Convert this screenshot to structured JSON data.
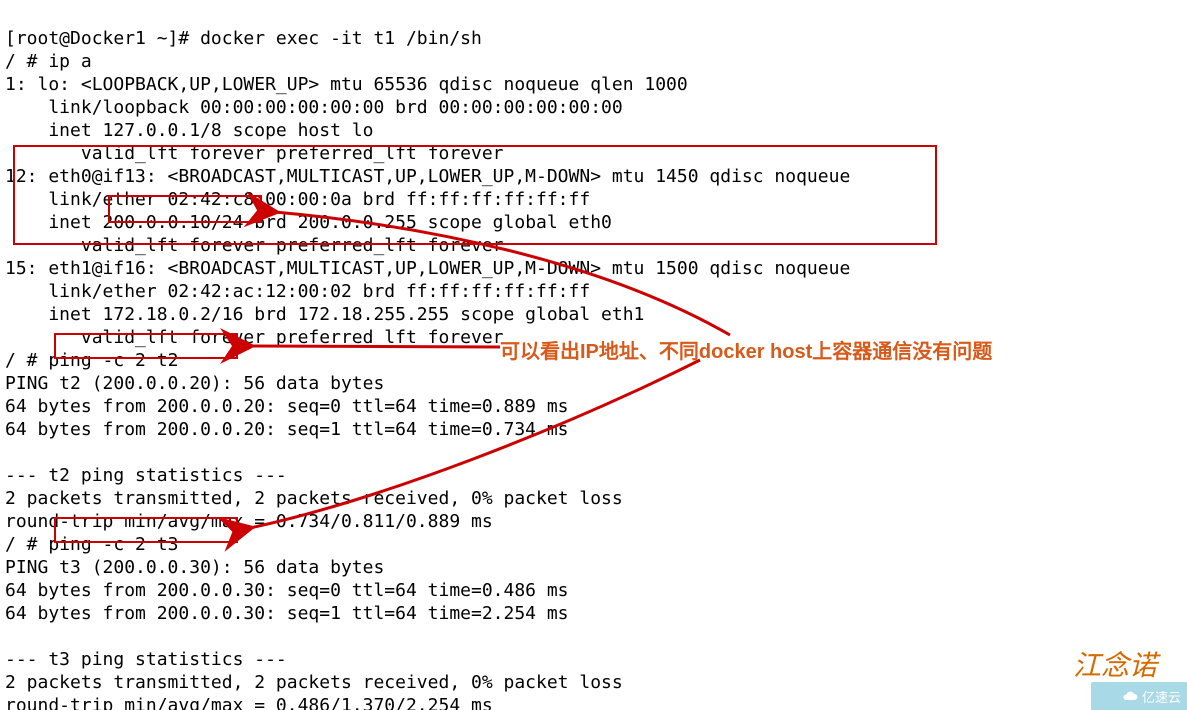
{
  "prompt1": "[root@Docker1 ~]# docker exec -it t1 /bin/sh",
  "prompt2": "/ # ip a",
  "lo_header": "1: lo: <LOOPBACK,UP,LOWER_UP> mtu 65536 qdisc noqueue qlen 1000",
  "lo_link": "    link/loopback 00:00:00:00:00:00 brd 00:00:00:00:00:00",
  "lo_inet": "    inet 127.0.0.1/8 scope host lo",
  "lo_valid": "       valid_lft forever preferred_lft forever",
  "eth0_header": "12: eth0@if13: <BROADCAST,MULTICAST,UP,LOWER_UP,M-DOWN> mtu 1450 qdisc noqueue",
  "eth0_link": "    link/ether 02:42:c8:00:00:0a brd ff:ff:ff:ff:ff:ff",
  "eth0_inet_pre": "    inet ",
  "eth0_ip": "200.0.0.10/24",
  "eth0_inet_post": " brd 200.0.0.255 scope global eth0",
  "eth0_valid": "       valid_lft forever preferred_lft forever",
  "eth1_header": "15: eth1@if16: <BROADCAST,MULTICAST,UP,LOWER_UP,M-DOWN> mtu 1500 qdisc noqueue",
  "eth1_link": "    link/ether 02:42:ac:12:00:02 brd ff:ff:ff:ff:ff:ff",
  "eth1_inet": "    inet 172.18.0.2/16 brd 172.18.255.255 scope global eth1",
  "eth1_valid": "       valid_lft forever preferred_lft forever",
  "ping_t2_prompt_pre": "/ # ",
  "ping_t2_cmd": "ping -c 2 t2",
  "ping_t2_line1": "PING t2 (200.0.0.20): 56 data bytes",
  "ping_t2_line2": "64 bytes from 200.0.0.20: seq=0 ttl=64 time=0.889 ms",
  "ping_t2_line3": "64 bytes from 200.0.0.20: seq=1 ttl=64 time=0.734 ms",
  "blank": "",
  "ping_t2_stats_hdr": "--- t2 ping statistics ---",
  "ping_t2_stats1": "2 packets transmitted, 2 packets received, 0% packet loss",
  "ping_t2_stats2": "round-trip min/avg/max = 0.734/0.811/0.889 ms",
  "ping_t3_prompt_pre": "/ # ",
  "ping_t3_cmd": "ping -c 2 t3",
  "ping_t3_line1": "PING t3 (200.0.0.30): 56 data bytes",
  "ping_t3_line2": "64 bytes from 200.0.0.30: seq=0 ttl=64 time=0.486 ms",
  "ping_t3_line3": "64 bytes from 200.0.0.30: seq=1 ttl=64 time=2.254 ms",
  "ping_t3_stats_hdr": "--- t3 ping statistics ---",
  "ping_t3_stats1": "2 packets transmitted, 2 packets received, 0% packet loss",
  "ping_t3_stats2": "round-trip min/avg/max = 0.486/1.370/2.254 ms",
  "annotation": "可以看出IP地址、不同docker host上容器通信没有问题",
  "watermark": "江念诺",
  "yisu_label": "亿速云"
}
